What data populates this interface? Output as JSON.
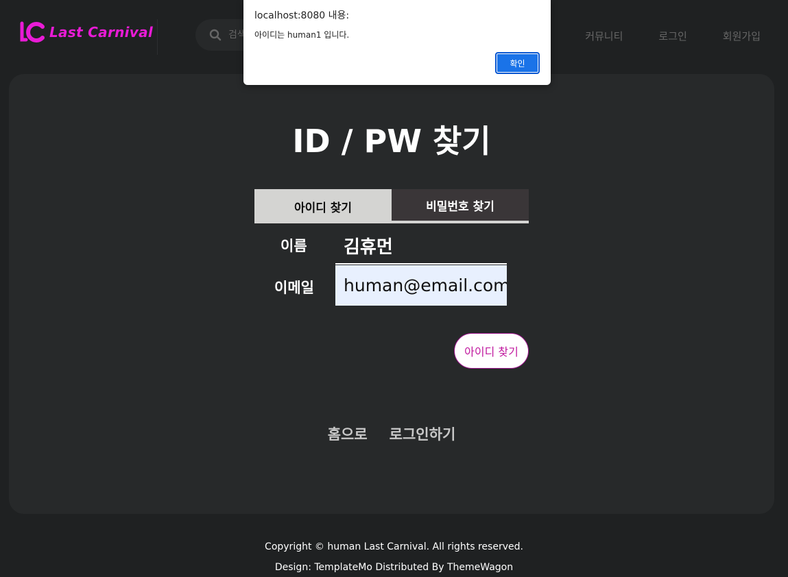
{
  "header": {
    "logo_text": "Last Carnival",
    "search_placeholder": "검색",
    "nav": [
      "커뮤니티",
      "로그인",
      "회원가입"
    ]
  },
  "main": {
    "title": "ID / PW 찾기",
    "tabs": [
      {
        "label": "아이디 찾기",
        "active": true
      },
      {
        "label": "비밀번호 찾기",
        "active": false
      }
    ],
    "name_label": "이름",
    "name_value": "김휴먼",
    "email_label": "이메일",
    "email_value": "human@email.com",
    "find_button": "아이디 찾기",
    "links": [
      "홈으로",
      "로그인하기"
    ]
  },
  "footer": {
    "line1": "Copyright © human Last Carnival. All rights reserved.",
    "line2": "Design: TemplateMo Distributed By ThemeWagon"
  },
  "alert": {
    "title": "localhost:8080 내용:",
    "message": "아이디는 human1 입니다.",
    "ok_label": "확인"
  },
  "colors": {
    "brand": "#e91bd6",
    "background": "#1f2122",
    "panel": "#27292a",
    "alert_button": "#1a73e8"
  }
}
